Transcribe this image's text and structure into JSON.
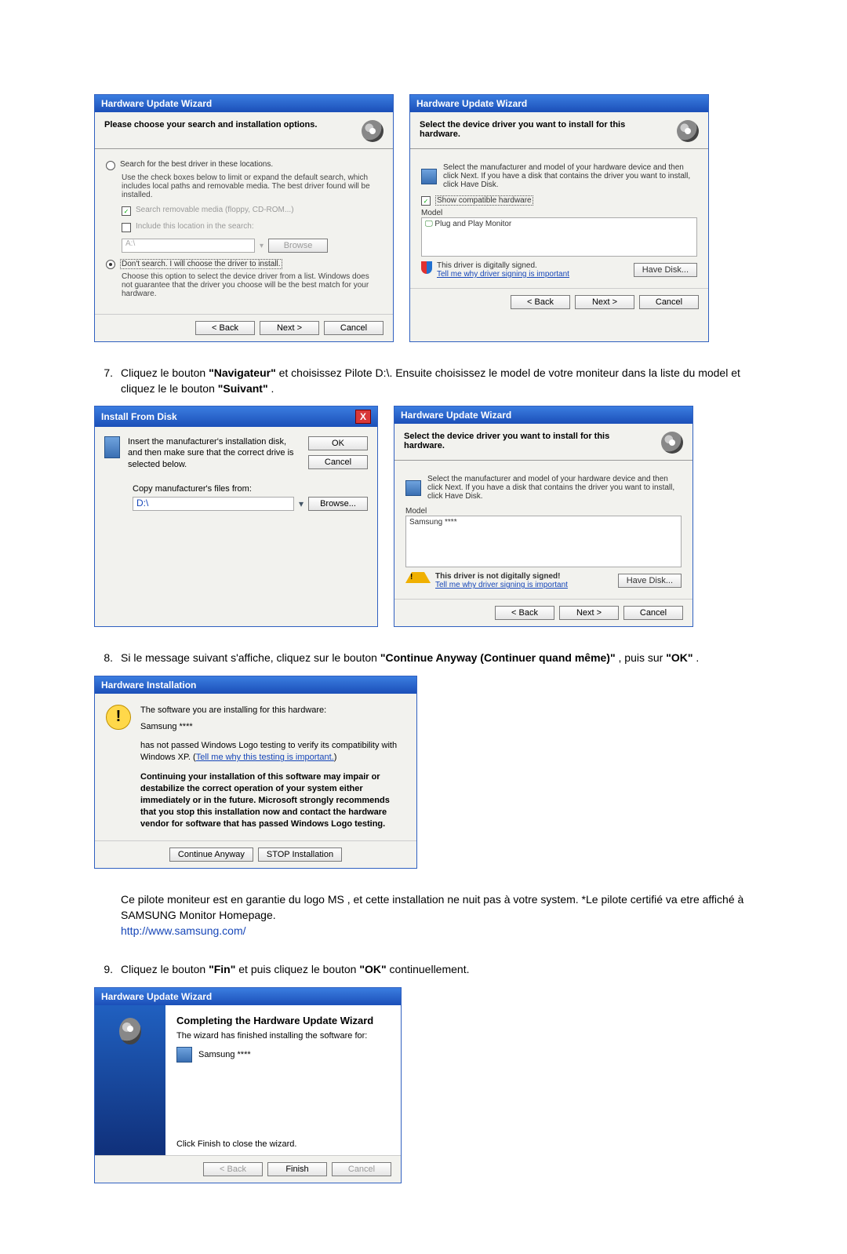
{
  "dlg1": {
    "title": "Hardware Update Wizard",
    "head": "Please choose your search and installation options.",
    "radio1": "Search for the best driver in these locations.",
    "radio1_desc": "Use the check boxes below to limit or expand the default search, which includes local paths and removable media. The best driver found will be installed.",
    "chk1": "Search removable media (floppy, CD-ROM...)",
    "chk2": "Include this location in the search:",
    "path": "A:\\",
    "browse_dis": "Browse",
    "radio2": "Don't search. I will choose the driver to install.",
    "radio2_desc": "Choose this option to select the device driver from a list. Windows does not guarantee that the driver you choose will be the best match for your hardware.",
    "back": "< Back",
    "next": "Next >",
    "cancel": "Cancel"
  },
  "dlg2": {
    "title": "Hardware Update Wizard",
    "head": "Select the device driver you want to install for this hardware.",
    "desc": "Select the manufacturer and model of your hardware device and then click Next. If you have a disk that contains the driver you want to install, click Have Disk.",
    "show_compat": "Show compatible hardware",
    "model_label": "Model",
    "model_item": "Plug and Play Monitor",
    "signed": "This driver is digitally signed.",
    "why_link": "Tell me why driver signing is important",
    "have_disk": "Have Disk...",
    "back": "< Back",
    "next": "Next >",
    "cancel": "Cancel"
  },
  "step7_num": "7.",
  "step7a": "Cliquez le bouton ",
  "step7b": "\"Navigateur\"",
  "step7c": " et choisissez Pilote D:\\. Ensuite choisissez le model de votre moniteur dans la liste du model et cliquez le le bouton ",
  "step7d": "\"Suivant\"",
  "step7e": ".",
  "ifd": {
    "title": "Install From Disk",
    "text": "Insert the manufacturer's installation disk, and then make sure that the correct drive is selected below.",
    "ok": "OK",
    "cancel": "Cancel",
    "copy_label": "Copy manufacturer's files from:",
    "path": "D:\\",
    "browse": "Browse..."
  },
  "dlg3": {
    "title": "Hardware Update Wizard",
    "head": "Select the device driver you want to install for this hardware.",
    "desc": "Select the manufacturer and model of your hardware device and then click Next. If you have a disk that contains the driver you want to install, click Have Disk.",
    "model_label": "Model",
    "model_item": "Samsung ****",
    "notsigned": "This driver is not digitally signed!",
    "why_link": "Tell me why driver signing is important",
    "have_disk": "Have Disk...",
    "back": "< Back",
    "next": "Next >",
    "cancel": "Cancel"
  },
  "step8_num": "8.",
  "step8a": "Si le message suivant s'affiche, cliquez sur le bouton ",
  "step8b": "\"Continue Anyway (Continuer quand même)\"",
  "step8c": ", puis sur ",
  "step8d": "\"OK\"",
  "step8e": ".",
  "hi": {
    "title": "Hardware Installation",
    "l1": "The software you are installing for this hardware:",
    "l2": "Samsung ****",
    "l3a": "has not passed Windows Logo testing to verify its compatibility with Windows XP. (",
    "l3link": "Tell me why this testing is important.",
    "l3b": ")",
    "bold": "Continuing your installation of this software may impair or destabilize the correct operation of your system either immediately or in the future. Microsoft strongly recommends that you stop this installation now and contact the hardware vendor for software that has passed Windows Logo testing.",
    "cont": "Continue Anyway",
    "stop": "STOP Installation"
  },
  "post8a": "Ce pilote moniteur est en garantie du logo MS , et cette installation ne nuit pas à votre system. *Le pilote certifié va etre affiché à SAMSUNG Monitor Homepage.",
  "post8_link": "http://www.samsung.com/",
  "step9_num": "9.",
  "step9a": "Cliquez le bouton ",
  "step9b": "\"Fin\"",
  "step9c": " et puis cliquez le bouton ",
  "step9d": "\"OK\"",
  "step9e": " continuellement.",
  "comp": {
    "title": "Hardware Update Wizard",
    "h": "Completing the Hardware Update Wizard",
    "l1": "The wizard has finished installing the software for:",
    "l2": "Samsung ****",
    "l3": "Click Finish to close the wizard.",
    "back": "< Back",
    "finish": "Finish",
    "cancel": "Cancel"
  }
}
